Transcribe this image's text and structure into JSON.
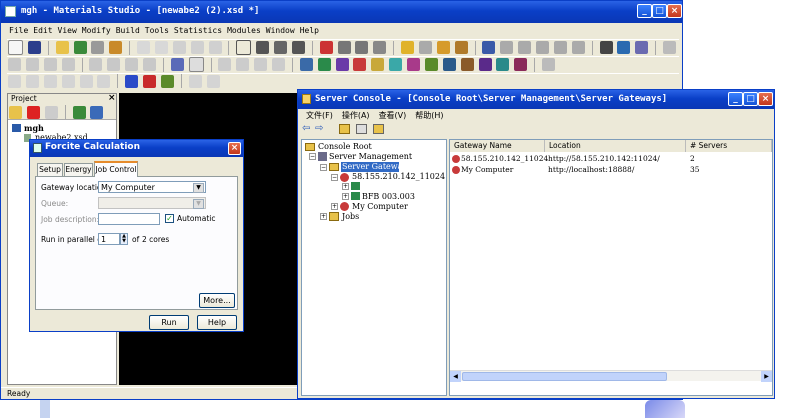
{
  "ms_window": {
    "title": "mgh - Materials Studio - [newabe2 (2).xsd *]",
    "menu": [
      "File",
      "Edit",
      "View",
      "Modify",
      "Build",
      "Tools",
      "Statistics",
      "Modules",
      "Window",
      "Help"
    ],
    "status": "Ready"
  },
  "project": {
    "header": "Project",
    "close": "×",
    "tree": [
      "mgh",
      "newabe2.xsd"
    ]
  },
  "dialog": {
    "title": "Forcite Calculation",
    "tabs": [
      "Setup",
      "Energy",
      "Job Control"
    ],
    "gateway_label": "Gateway location:",
    "gateway_value": "My Computer",
    "queue_label": "Queue:",
    "jobdesc_label": "Job description:",
    "automatic_label": "Automatic",
    "parallel_label": "Run in parallel on:",
    "parallel_value": "1",
    "parallel_of": "of",
    "parallel_cores": "2 cores",
    "more_button": "More...",
    "run_button": "Run",
    "help_button": "Help"
  },
  "console": {
    "title": "Server Console - [Console Root\\Server Management\\Server Gateways]",
    "menu": [
      "文件(F)",
      "操作(A)",
      "查看(V)",
      "帮助(H)"
    ],
    "tree": {
      "root": "Console Root",
      "server_management": "Server Management",
      "server_gateways": "Server Gateways",
      "gateway1": "58.155.210.142_11024",
      "sub_node": "BFB 003.003",
      "my_computer": "My Computer",
      "jobs": "Jobs"
    },
    "columns": [
      "Gateway Name",
      "Location",
      "# Servers"
    ],
    "rows": [
      {
        "name": "58.155.210.142_11024",
        "location": "http://58.155.210.142:11024/",
        "servers": "2"
      },
      {
        "name": "My Computer",
        "location": "http://localhost:18888/",
        "servers": "35"
      }
    ]
  },
  "colors": {
    "title_bar": "#0a3fc7",
    "chrome": "#ece9d8",
    "viewport": "#000000",
    "selection": "#316ac5"
  }
}
